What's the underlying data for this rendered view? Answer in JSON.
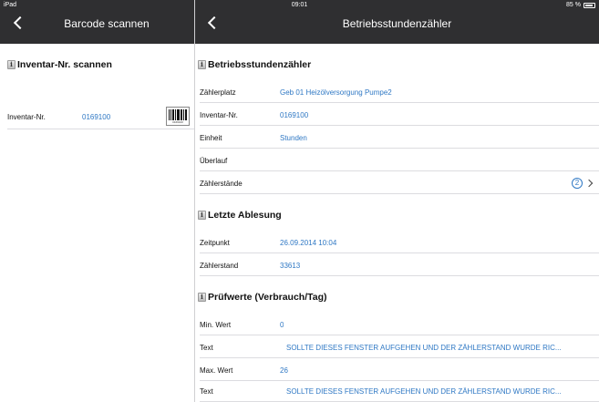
{
  "status": {
    "device": "iPad",
    "time": "09:01",
    "battery": "85 %"
  },
  "left": {
    "title": "Barcode scannen",
    "section": "Inventar-Nr. scannen",
    "row": {
      "label": "Inventar-Nr.",
      "value": "0169100",
      "barcode_text": "0169100"
    }
  },
  "right": {
    "title": "Betriebsstundenzähler",
    "sections": [
      {
        "header": "Betriebsstundenzähler",
        "rows": [
          {
            "label": "Zählerplatz",
            "value": "Geb 01 Heizölversorgung Pumpe2"
          },
          {
            "label": "Inventar-Nr.",
            "value": "0169100"
          },
          {
            "label": "Einheit",
            "value": "Stunden"
          },
          {
            "label": "Überlauf",
            "value": ""
          },
          {
            "label": "Zählerstände",
            "value": "",
            "badge": "2"
          }
        ]
      },
      {
        "header": "Letzte Ablesung",
        "rows": [
          {
            "label": "Zeitpunkt",
            "value": "26.09.2014 10:04"
          },
          {
            "label": "Zählerstand",
            "value": "33613"
          }
        ]
      },
      {
        "header": "Prüfwerte (Verbrauch/Tag)",
        "rows": [
          {
            "label": "Min. Wert",
            "value": "0"
          },
          {
            "label": "Text",
            "value": "SOLLTE DIESES FENSTER AUFGEHEN UND DER ZÄHLERSTAND WURDE RIC..."
          },
          {
            "label": "Max. Wert",
            "value": "26"
          },
          {
            "label": "Text",
            "value": "SOLLTE DIESES FENSTER AUFGEHEN UND DER ZÄHLERSTAND WURDE RIC..."
          }
        ]
      }
    ]
  }
}
